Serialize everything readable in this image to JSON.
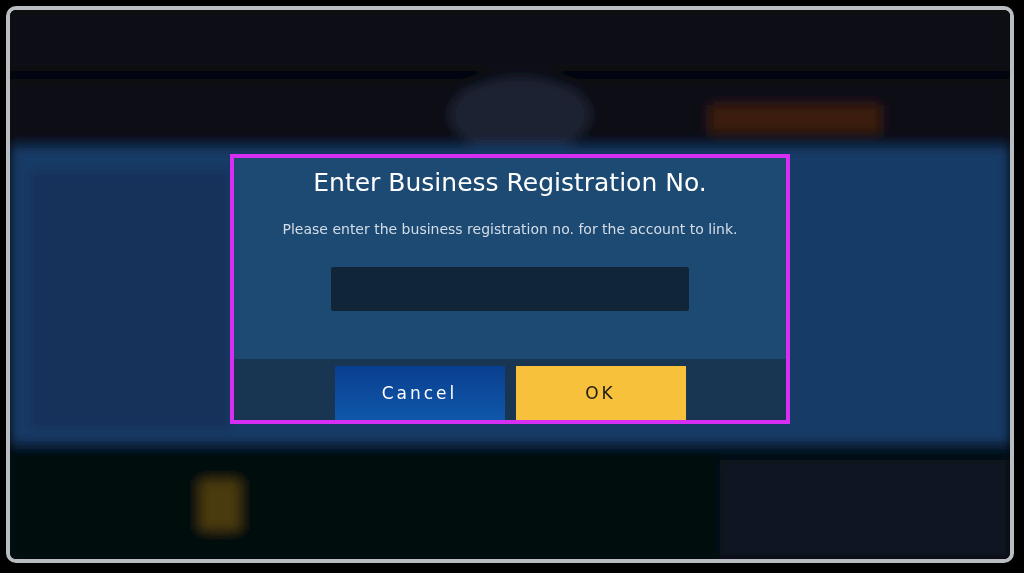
{
  "dialog": {
    "title": "Enter Business Registration No.",
    "message": "Please enter the business registration no. for the account to link.",
    "buttons": [
      {
        "label": "Cancel",
        "kind": "secondary"
      },
      {
        "label": "OK",
        "kind": "primary"
      }
    ]
  }
}
